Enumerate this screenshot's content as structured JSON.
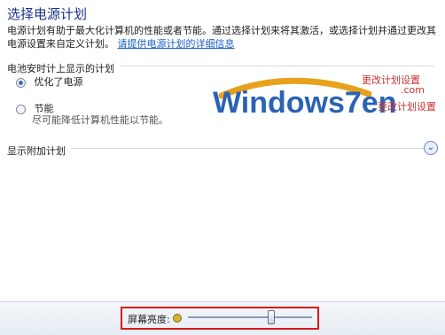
{
  "page": {
    "title": "选择电源计划",
    "intro": "电源计划有助于最大化计算机的性能或者节能。通过选择计划来将其激活，或选择计划并通过更改其电源设置来自定义计划。",
    "intro_link": "请提供电源计划的详细信息"
  },
  "battery_section": {
    "header": "电池安时计上显示的计划",
    "options": [
      {
        "label": "优化了电源",
        "checked": true,
        "description": ""
      },
      {
        "label": "节能",
        "checked": false,
        "description": "尽可能降低计算机性能以节能。"
      }
    ]
  },
  "more_plans": {
    "label": "显示附加计划",
    "expand_icon": "chevron-down-icon"
  },
  "watermark": {
    "logo_text": "Windows7en",
    "sub_text_1": "更改计划设置",
    "sub_text_2": ".com",
    "sub_text_3": "更改计划设置"
  },
  "bottom_bar": {
    "brightness_label": "屏幕亮度:",
    "brightness_value": 0.75,
    "icon": "sun-icon"
  },
  "colors": {
    "title": "#1e3287",
    "link": "#1a5fc8",
    "highlight_box": "#d8191a",
    "watermark_blue": "#2b63b4",
    "watermark_orange": "#e8a11c"
  }
}
